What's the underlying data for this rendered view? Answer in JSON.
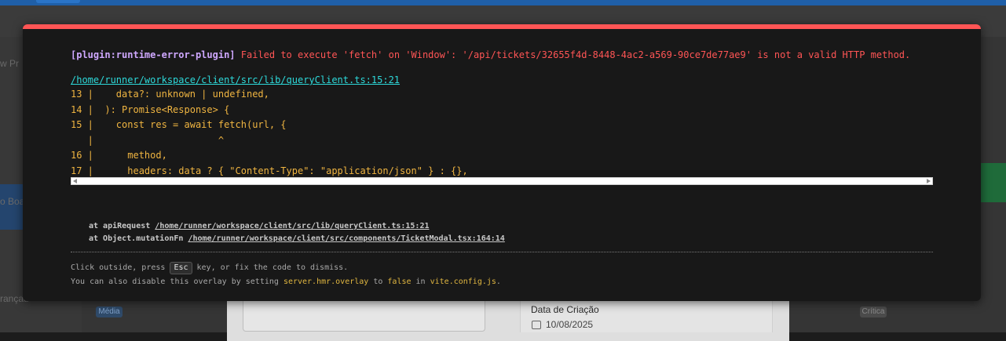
{
  "background": {
    "sidebar_labels": [
      "w Pr",
      "o Boar",
      "rançad"
    ],
    "field_label": "Data de Criação",
    "field_date": "10/08/2025",
    "badge_left": "Média",
    "badge_right": "Crítica"
  },
  "overlay": {
    "plugin_tag": "[plugin:runtime-error-plugin]",
    "message": "Failed to execute 'fetch' on 'Window': '/api/tickets/32655f4d-8448-4ac2-a569-90ce7de77ae9' is not a valid HTTP method.",
    "file": "/home/runner/workspace/client/src/lib/queryClient.ts:15:21",
    "frame_lines": [
      "13 |    data?: unknown | undefined,",
      "14 |  ): Promise<Response> {",
      "15 |    const res = await fetch(url, {",
      "   |                      ^",
      "16 |      method,",
      "17 |      headers: data ? { \"Content-Type\": \"application/json\" } : {},"
    ],
    "stack": [
      {
        "prefix": "at apiRequest ",
        "link": "/home/runner/workspace/client/src/lib/queryClient.ts:15:21"
      },
      {
        "prefix": "at Object.mutationFn ",
        "link": "/home/runner/workspace/client/src/components/TicketModal.tsx:164:14"
      }
    ],
    "tip1_before": "Click outside, press ",
    "tip1_key": "Esc",
    "tip1_after": " key, or fix the code to dismiss.",
    "tip2_before": "You can also disable this overlay by setting ",
    "tip2_code1": "server.hmr.overlay",
    "tip2_mid": " to ",
    "tip2_code2": "false",
    "tip2_mid2": " in ",
    "tip2_code3": "vite.config.js",
    "tip2_end": "."
  },
  "colors": {
    "accent_red": "#ff5555",
    "plugin_purple": "#cfa8ff",
    "link_cyan": "#2dd9da",
    "code_yellow": "#f0b541"
  }
}
